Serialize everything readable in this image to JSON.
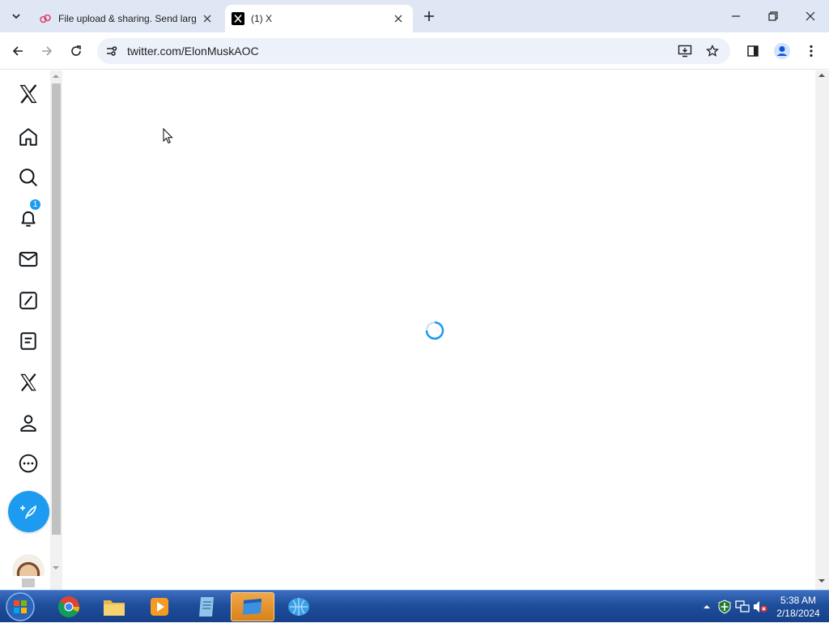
{
  "browser": {
    "tabs": [
      {
        "title": "File upload & sharing. Send larg",
        "favicon": "cloud-link-icon",
        "active": false
      },
      {
        "title": "(1) X",
        "favicon": "x-logo-icon",
        "active": true
      }
    ],
    "url": "twitter.com/ElonMuskAOC"
  },
  "x_nav": {
    "items": [
      "x-logo-icon",
      "home-icon",
      "search-icon",
      "bell-icon",
      "mail-icon",
      "grok-icon",
      "lists-icon",
      "premium-x-icon",
      "profile-icon",
      "more-icon"
    ],
    "notification_count": "1",
    "post_button_icon": "feather-plus-icon"
  },
  "content": {
    "state": "loading"
  },
  "taskbar": {
    "apps": [
      "chrome-icon",
      "file-explorer-icon",
      "media-player-icon",
      "notepad-icon",
      "active-window-icon",
      "network-globe-icon"
    ],
    "time": "5:38 AM",
    "date": "2/18/2024"
  },
  "colors": {
    "accent": "#1d9bf0",
    "tab_strip": "#dfe7f5",
    "omnibox": "#edf2fa",
    "taskbar": "#1f4e9b"
  }
}
